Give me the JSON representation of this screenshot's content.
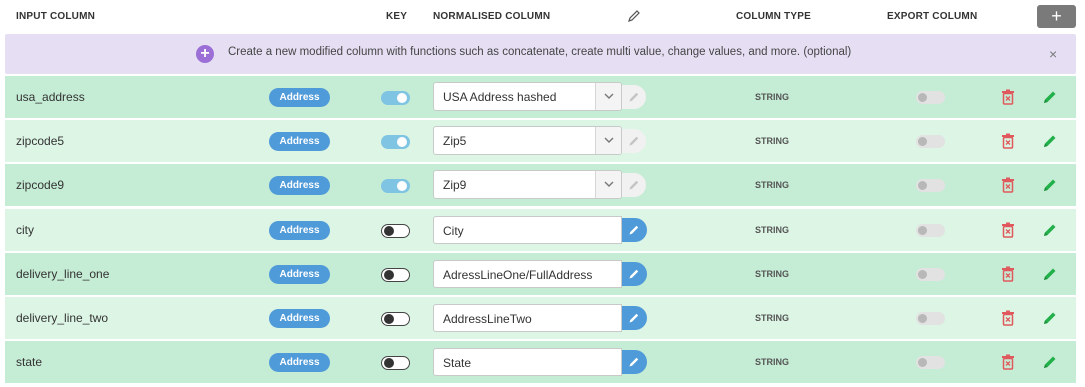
{
  "header": {
    "input_column": "INPUT COLUMN",
    "key": "KEY",
    "normalised_column": "NORMALISED COLUMN",
    "column_type": "COLUMN TYPE",
    "export_column": "EXPORT COLUMN",
    "add_button": "+"
  },
  "banner": {
    "plus": "+",
    "text": "Create a new modified column with functions such as concatenate, create multi value, change values, and more. (optional)",
    "close": "×"
  },
  "colors": {
    "row_dark": "#c5ecd4",
    "row_light": "#dcf5e4",
    "badge": "#4f9ad9",
    "toggle_on": "#7fc4e3",
    "trash": "#e0595c",
    "edit_green": "#22b04a",
    "banner_bg": "#e6dff4",
    "banner_plus": "#9b6fd6"
  },
  "rows": [
    {
      "name": "usa_address",
      "badge": "Address",
      "key_on": true,
      "norm_type": "select",
      "norm_value": "USA Address hashed",
      "column_type": "STRING"
    },
    {
      "name": "zipcode5",
      "badge": "Address",
      "key_on": true,
      "norm_type": "select",
      "norm_value": "Zip5",
      "column_type": "STRING"
    },
    {
      "name": "zipcode9",
      "badge": "Address",
      "key_on": true,
      "norm_type": "select",
      "norm_value": "Zip9",
      "column_type": "STRING"
    },
    {
      "name": "city",
      "badge": "Address",
      "key_on": false,
      "norm_type": "input",
      "norm_value": "City",
      "column_type": "STRING"
    },
    {
      "name": "delivery_line_one",
      "badge": "Address",
      "key_on": false,
      "norm_type": "input",
      "norm_value": "AdressLineOne/FullAddress",
      "column_type": "STRING"
    },
    {
      "name": "delivery_line_two",
      "badge": "Address",
      "key_on": false,
      "norm_type": "input",
      "norm_value": "AddressLineTwo",
      "column_type": "STRING"
    },
    {
      "name": "state",
      "badge": "Address",
      "key_on": false,
      "norm_type": "input",
      "norm_value": "State",
      "column_type": "STRING"
    }
  ]
}
